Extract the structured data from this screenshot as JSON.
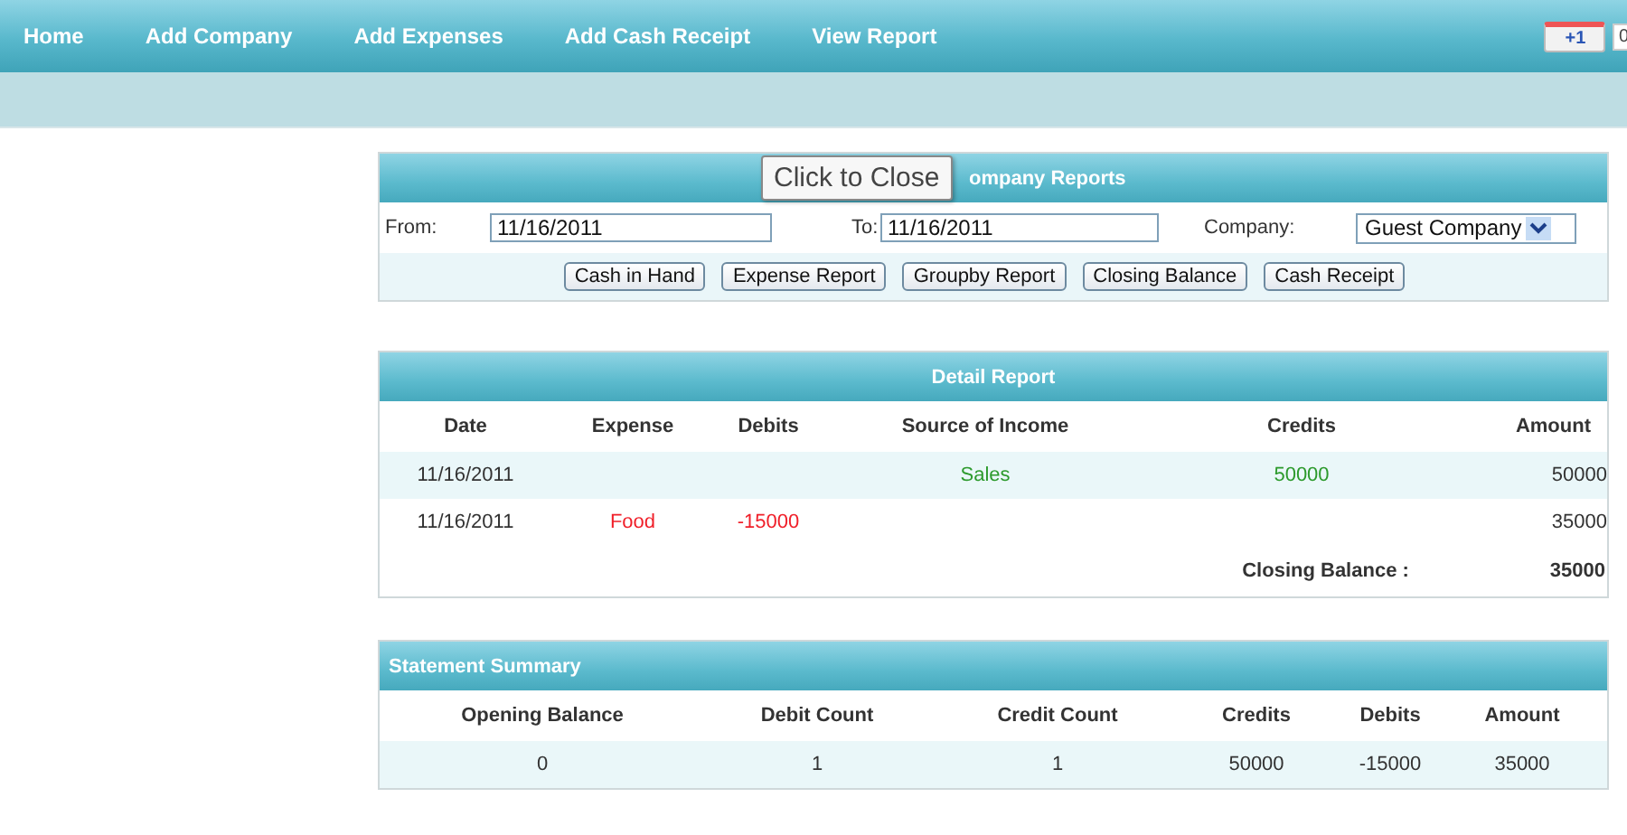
{
  "nav": {
    "items": [
      "Home",
      "Add Company",
      "Add Expenses",
      "Add Cash Receipt",
      "View Report"
    ],
    "plus_one": {
      "label": "+1",
      "count": "0"
    }
  },
  "company_reports": {
    "title": "ompany Reports",
    "tooltip": "Click to Close",
    "from": {
      "label": "From:",
      "value": "11/16/2011"
    },
    "to": {
      "label": "To:",
      "value": "11/16/2011"
    },
    "company": {
      "label": "Company:",
      "value": "Guest Company"
    },
    "buttons": [
      "Cash in Hand",
      "Expense Report",
      "Groupby Report",
      "Closing Balance",
      "Cash Receipt"
    ]
  },
  "detail_report": {
    "title": "Detail Report",
    "columns": [
      "Date",
      "Expense",
      "Debits",
      "Source of Income",
      "Credits",
      "Amount"
    ],
    "rows": [
      {
        "kind": "income",
        "cells": [
          "11/16/2011",
          "",
          "",
          "Sales",
          "50000",
          "50000"
        ]
      },
      {
        "kind": "expense",
        "cells": [
          "11/16/2011",
          "Food",
          "-15000",
          "",
          "",
          "35000"
        ]
      }
    ],
    "closing": {
      "label": "Closing Balance :",
      "value": "35000"
    }
  },
  "statement_summary": {
    "title": "Statement Summary",
    "columns": [
      "Opening Balance",
      "Debit Count",
      "Credit Count",
      "Credits",
      "Debits",
      "Amount"
    ],
    "rows": [
      [
        "0",
        "1",
        "1",
        "50000",
        "-15000",
        "35000"
      ]
    ]
  }
}
